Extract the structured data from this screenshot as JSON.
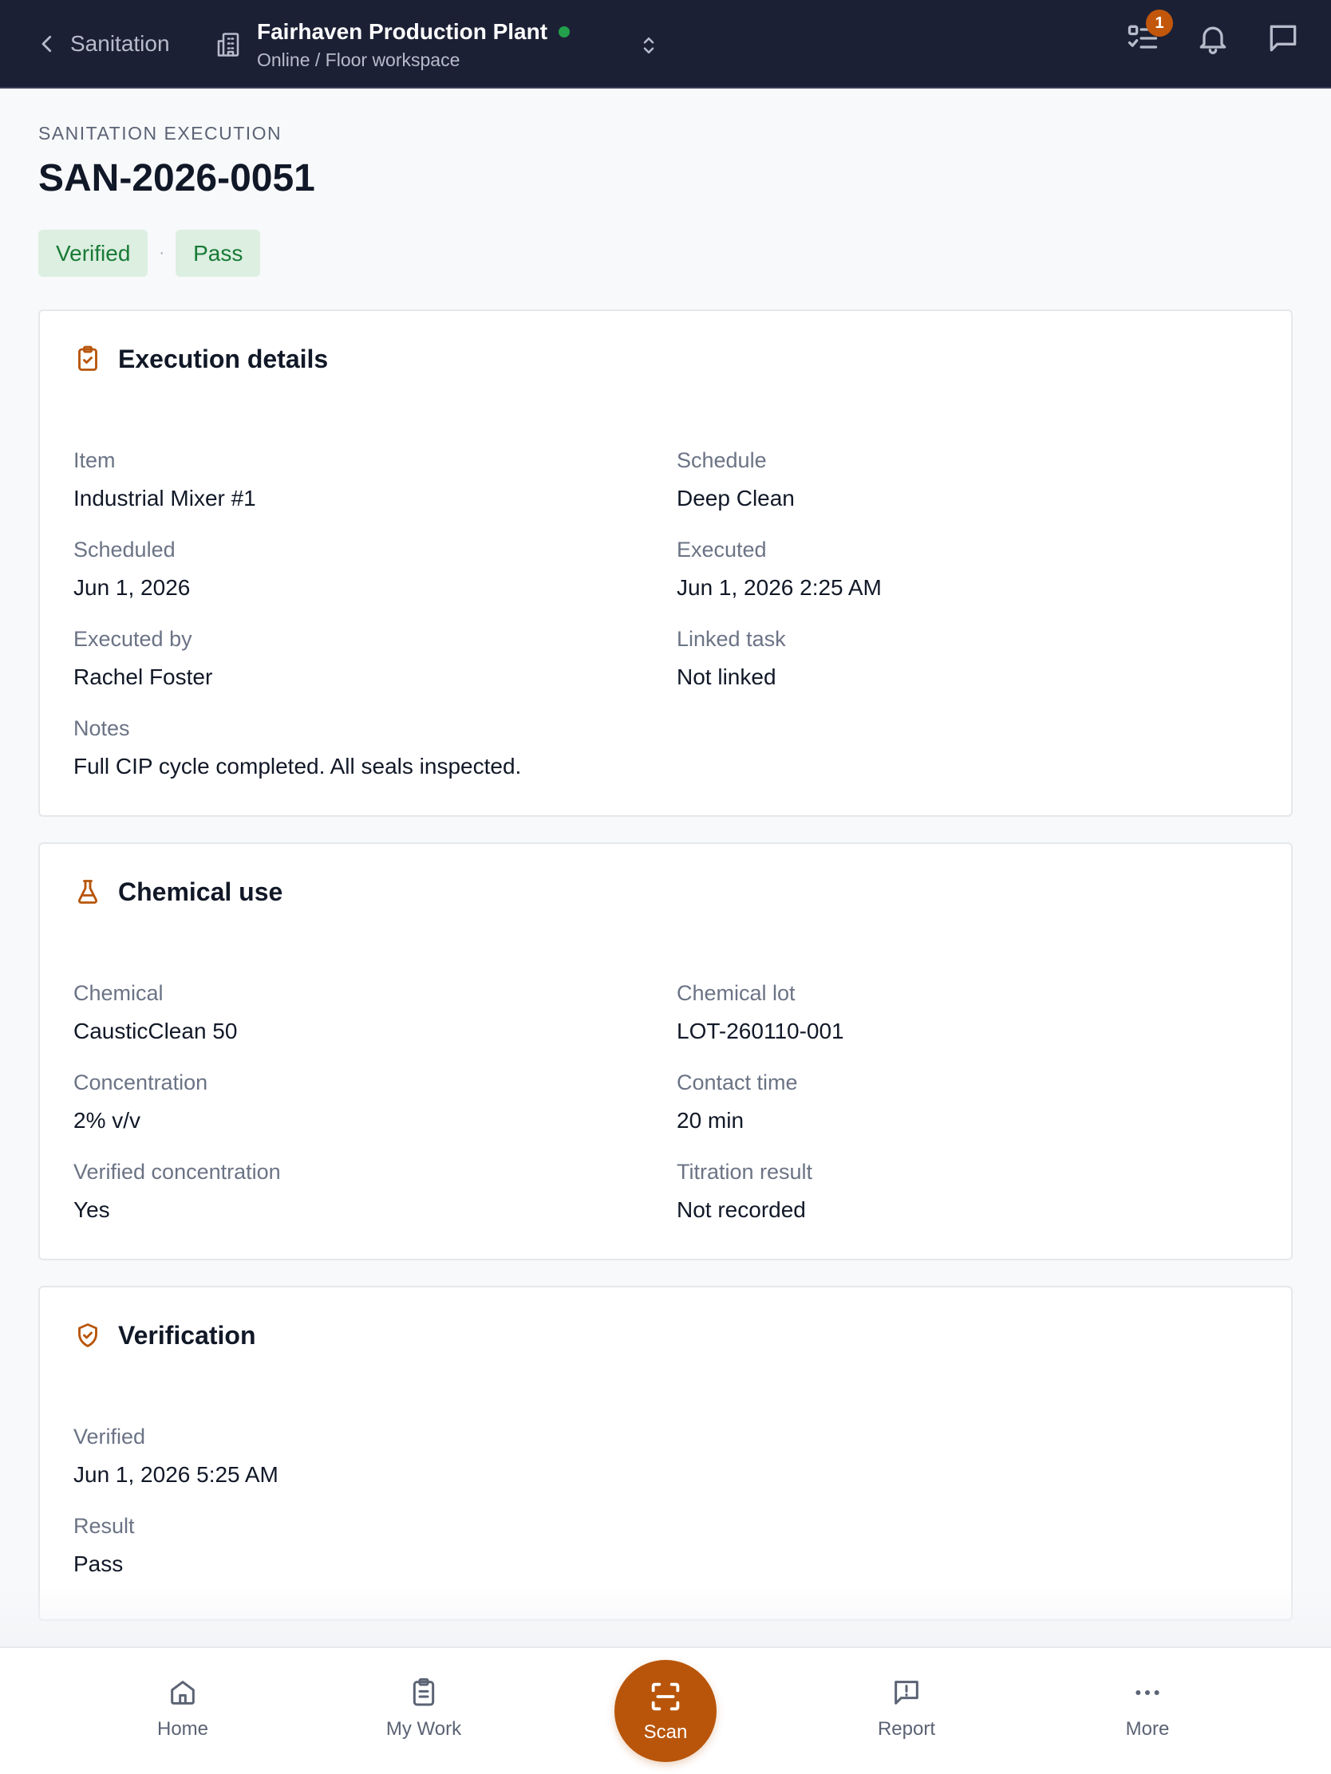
{
  "topbar": {
    "back_label": "Sanitation",
    "site_name": "Fairhaven Production Plant",
    "site_sub": "Online / Floor workspace",
    "tasks_badge": "1"
  },
  "header": {
    "eyebrow": "SANITATION EXECUTION",
    "title": "SAN-2026-0051",
    "status_pills": [
      "Verified",
      "Pass"
    ],
    "separator": "·"
  },
  "execution": {
    "title": "Execution details",
    "fields": [
      {
        "label": "Item",
        "value": "Industrial Mixer #1"
      },
      {
        "label": "Schedule",
        "value": "Deep Clean"
      },
      {
        "label": "Scheduled",
        "value": "Jun 1, 2026"
      },
      {
        "label": "Executed",
        "value": "Jun 1, 2026 2:25 AM"
      },
      {
        "label": "Executed by",
        "value": "Rachel Foster"
      },
      {
        "label": "Linked task",
        "value": "Not linked"
      },
      {
        "label": "Notes",
        "value": "Full CIP cycle completed. All seals inspected."
      }
    ]
  },
  "chemical": {
    "title": "Chemical use",
    "fields": [
      {
        "label": "Chemical",
        "value": "CausticClean 50"
      },
      {
        "label": "Chemical lot",
        "value": "LOT-260110-001"
      },
      {
        "label": "Concentration",
        "value": "2% v/v"
      },
      {
        "label": "Contact time",
        "value": "20 min"
      },
      {
        "label": "Verified concentration",
        "value": "Yes"
      },
      {
        "label": "Titration result",
        "value": "Not recorded"
      }
    ]
  },
  "verification": {
    "title": "Verification",
    "fields": [
      {
        "label": "Verified",
        "value": "Jun 1, 2026 5:25 AM"
      },
      {
        "label": "Result",
        "value": "Pass"
      }
    ]
  },
  "bottom_nav": {
    "home": "Home",
    "my_work": "My Work",
    "scan": "Scan",
    "report": "Report",
    "more": "More"
  },
  "colors": {
    "topbar_bg": "#1c2035",
    "accent": "#b8550a",
    "status_green": "#187a35",
    "status_green_bg": "#dcefe1",
    "online_dot": "#22a04b"
  },
  "icons": {
    "back": "chevron-left-icon",
    "site": "building-icon",
    "switch": "chevron-up-down-icon",
    "tasks": "checklist-icon",
    "notifications": "bell-icon",
    "messages": "message-icon",
    "execution": "clipboard-check-icon",
    "chemical": "flask-icon",
    "verification": "shield-check-icon",
    "home": "home-icon",
    "my_work": "clipboard-list-icon",
    "scan": "scan-icon",
    "report": "message-alert-icon",
    "more": "ellipsis-icon"
  }
}
